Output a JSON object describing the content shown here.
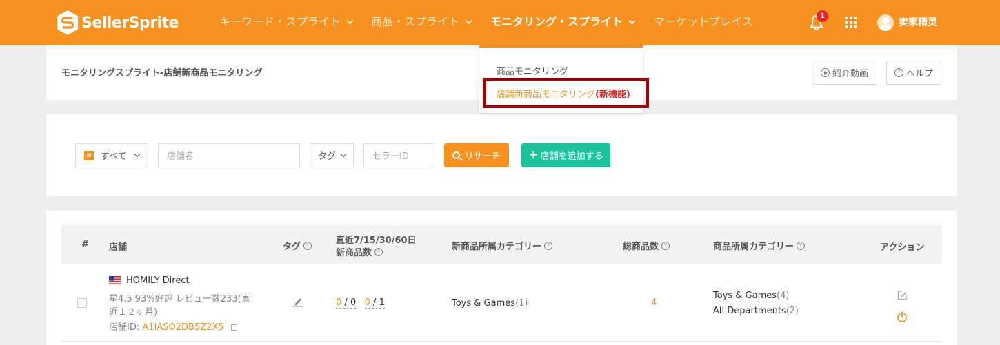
{
  "brand": {
    "name": "SellerSprite",
    "accent": "#f79220",
    "highlight_box": "#8f0d0d"
  },
  "nav": {
    "items": [
      {
        "label": "キーワード・スプライト",
        "has_dropdown": true
      },
      {
        "label": "商品・スプライト",
        "has_dropdown": true
      },
      {
        "label": "モニタリング・スプライト",
        "has_dropdown": true,
        "active": true
      },
      {
        "label": "マーケットプレイス",
        "has_dropdown": false
      }
    ],
    "notification_count": "1",
    "user_name": "卖家精灵"
  },
  "dropdown": {
    "item_1": "商品モニタリング",
    "item_2_main": "店舗新商品モニタリング",
    "item_2_tag": "(新機能)"
  },
  "page": {
    "breadcrumb": "モニタリングスプライト-店舗新商品モニタリング",
    "video_button": "紹介動画",
    "help_button": "ヘルプ"
  },
  "filters": {
    "marketplace_value": "すべて",
    "store_placeholder": "店舗名",
    "tag_value": "タグ",
    "seller_id_placeholder": "セラーID",
    "search_button": "リサーチ",
    "add_button": "店舗を追加する"
  },
  "table": {
    "headers": {
      "index": "#",
      "store": "店舗",
      "tag": "タグ",
      "new_products_line1": "直近7/15/30/60日",
      "new_products_line2": "新商品数",
      "new_category": "新商品所属カテゴリー",
      "total_products": "総商品数",
      "category": "商品所属カテゴリー",
      "action": "アクション"
    },
    "rows": [
      {
        "store_name": "HOMILY Direct",
        "store_meta_line1": "星4.5  93%好評  レビュー数233(直",
        "store_meta_line2": "近１２ヶ月)",
        "store_id_label": "店舗ID:",
        "store_id": "A1IASO2DB5Z2X5",
        "new_7": "0",
        "new_15": "0",
        "new_30": "0",
        "new_60": "1",
        "new_category_name": "Toys & Games",
        "new_category_count": "(1)",
        "total_products": "4",
        "categories": [
          {
            "name": "Toys & Games",
            "count": "(4)"
          },
          {
            "name": "All Departments",
            "count": "(2)"
          }
        ]
      }
    ]
  }
}
